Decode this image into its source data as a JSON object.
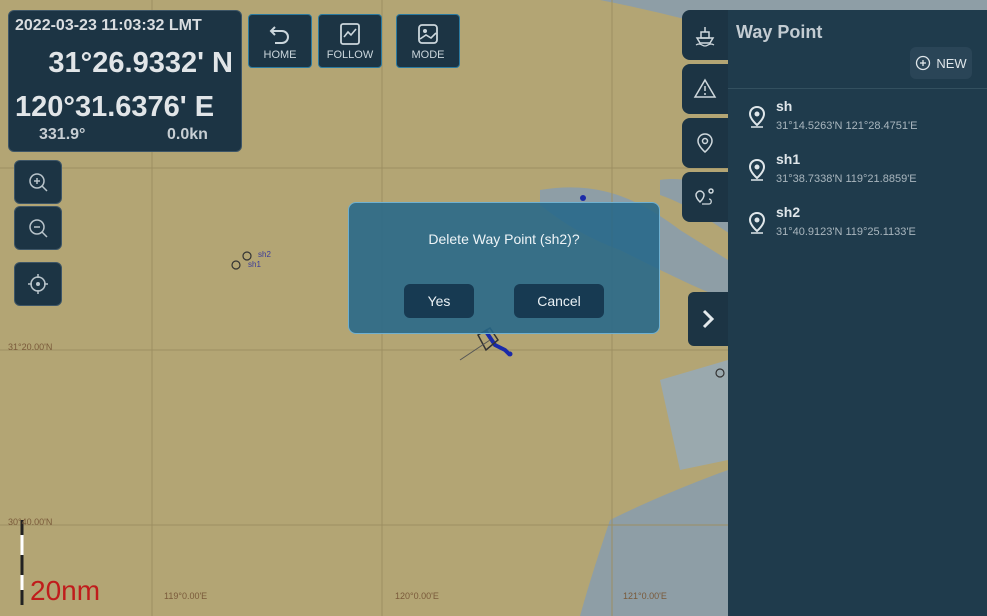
{
  "status": {
    "datetime": "2022-03-23 11:03:32 LMT",
    "latitude": "31°26.9332' N",
    "longitude": "120°31.6376' E",
    "heading": "331.9°",
    "speed": "0.0kn"
  },
  "toolbar": {
    "home_label": "HOME",
    "follow_label": "FOLLOW",
    "mode_label": "MODE"
  },
  "map_labels": {
    "lat_1": "31°20.00'N",
    "lat_2": "30°40.00'N",
    "lon_1": "119°0.00'E",
    "lon_2": "120°0.00'E",
    "lon_3": "121°0.00'E",
    "wp_sh2": "sh2",
    "wp_sh1": "sh1",
    "scale": "20nm"
  },
  "panel": {
    "title": "Way Point",
    "new_label": "NEW",
    "waypoints": [
      {
        "name": "sh",
        "coord": "31°14.5263'N  121°28.4751'E"
      },
      {
        "name": "sh1",
        "coord": "31°38.7338'N  119°21.8859'E"
      },
      {
        "name": "sh2",
        "coord": "31°40.9123'N  119°25.1133'E"
      }
    ]
  },
  "dialog": {
    "message": "Delete Way Point (sh2)?",
    "yes_label": "Yes",
    "cancel_label": "Cancel"
  },
  "colors": {
    "land": "#b3a574",
    "water": "#8e9ea6",
    "panel": "#1f3b4c",
    "dialog": "#26688a"
  }
}
